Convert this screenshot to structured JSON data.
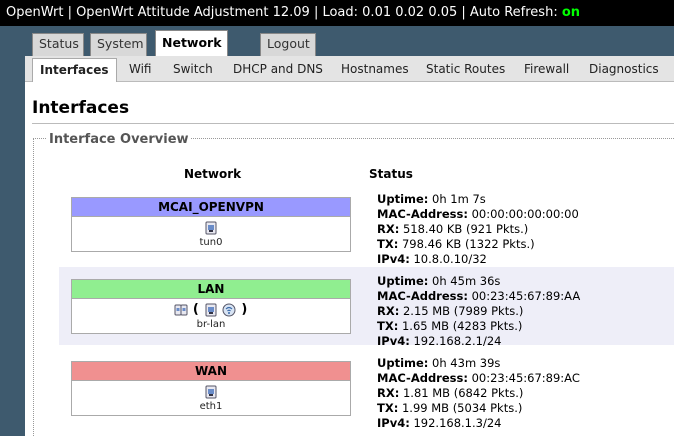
{
  "header": {
    "text": "OpenWrt | OpenWrt Attitude Adjustment 12.09 | Load: 0.01 0.02 0.05 | Auto Refresh: ",
    "refresh_state": "on"
  },
  "tabs": {
    "status": "Status",
    "system": "System",
    "network": "Network",
    "logout": "Logout"
  },
  "subtabs": {
    "interfaces": "Interfaces",
    "wifi": "Wifi",
    "switch": "Switch",
    "dhcp": "DHCP and DNS",
    "hostnames": "Hostnames",
    "static_routes": "Static Routes",
    "firewall": "Firewall",
    "diagnostics": "Diagnostics"
  },
  "page": {
    "title": "Interfaces",
    "legend": "Interface Overview",
    "col_network": "Network",
    "col_status": "Status"
  },
  "labels": {
    "uptime": "Uptime:",
    "mac": "MAC-Address:",
    "rx": "RX:",
    "tx": "TX:",
    "ipv4": "IPv4:"
  },
  "interfaces": [
    {
      "name": "MCAI_OPENVPN",
      "color": "#9999ff",
      "device": "tun0",
      "uptime": "0h 1m 7s",
      "mac": "00:00:00:00:00:00",
      "rx": "518.40 KB (921 Pkts.)",
      "tx": "798.46 KB (1322 Pkts.)",
      "ipv4": "10.8.0.10/32"
    },
    {
      "name": "LAN",
      "color": "#90ee90",
      "device": "br-lan",
      "uptime": "0h 45m 36s",
      "mac": "00:23:45:67:89:AA",
      "rx": "2.15 MB (7989 Pkts.)",
      "tx": "1.65 MB (4283 Pkts.)",
      "ipv4": "192.168.2.1/24"
    },
    {
      "name": "WAN",
      "color": "#f09090",
      "device": "eth1",
      "uptime": "0h 43m 39s",
      "mac": "00:23:45:67:89:AC",
      "rx": "1.81 MB (6842 Pkts.)",
      "tx": "1.99 MB (5034 Pkts.)",
      "ipv4": "192.168.1.3/24"
    }
  ]
}
